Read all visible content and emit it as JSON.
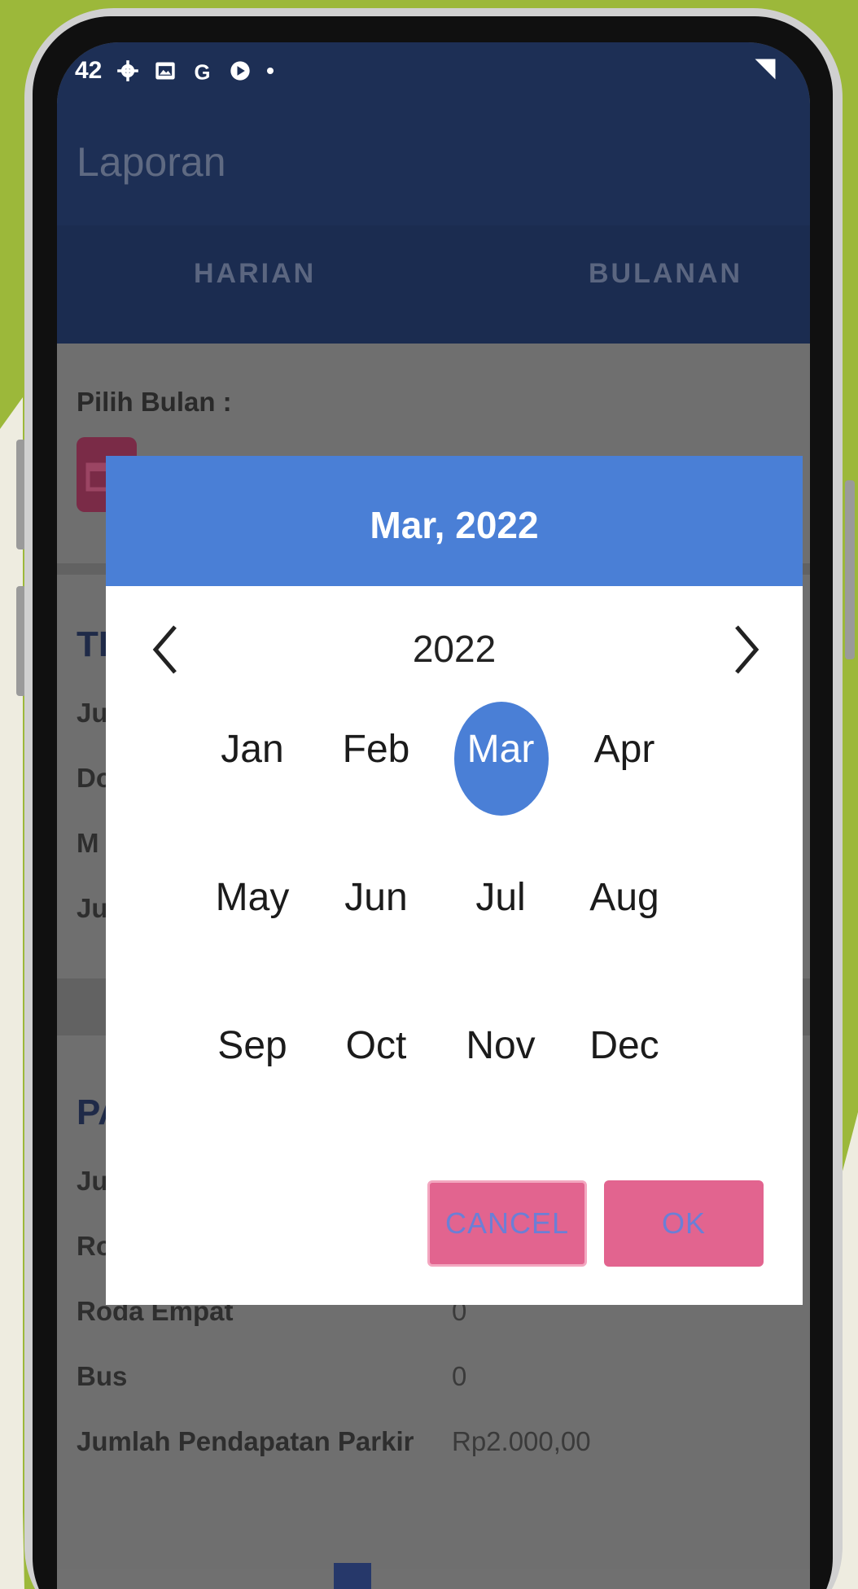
{
  "status_bar": {
    "time": "42"
  },
  "app": {
    "title": "Laporan"
  },
  "tabs": [
    {
      "label": "HARIAN"
    },
    {
      "label": "BULANAN"
    }
  ],
  "filter": {
    "label": "Pilih Bulan :"
  },
  "background_rows": {
    "section1_heading": "TI",
    "section1_rows": [
      "Ju",
      "Do",
      "M",
      "Ju"
    ],
    "section2_heading": "PA",
    "section2_rows": [
      {
        "label": "Ju",
        "value": ""
      },
      {
        "label": "Ro",
        "value": ""
      },
      {
        "label": "Roda Empat",
        "value": "0"
      },
      {
        "label": "Bus",
        "value": "0"
      },
      {
        "label": "Jumlah Pendapatan Parkir",
        "value": "Rp2.000,00"
      }
    ]
  },
  "dialog": {
    "header": "Mar, 2022",
    "year": "2022",
    "months": [
      "Jan",
      "Feb",
      "Mar",
      "Apr",
      "May",
      "Jun",
      "Jul",
      "Aug",
      "Sep",
      "Oct",
      "Nov",
      "Dec"
    ],
    "selected_month": "Mar",
    "cancel_label": "CANCEL",
    "ok_label": "OK"
  },
  "colors": {
    "accent": "#4a7fd6",
    "button": "#e2648f",
    "appbar": "#1d2f55",
    "background_green": "#9cb83a"
  }
}
